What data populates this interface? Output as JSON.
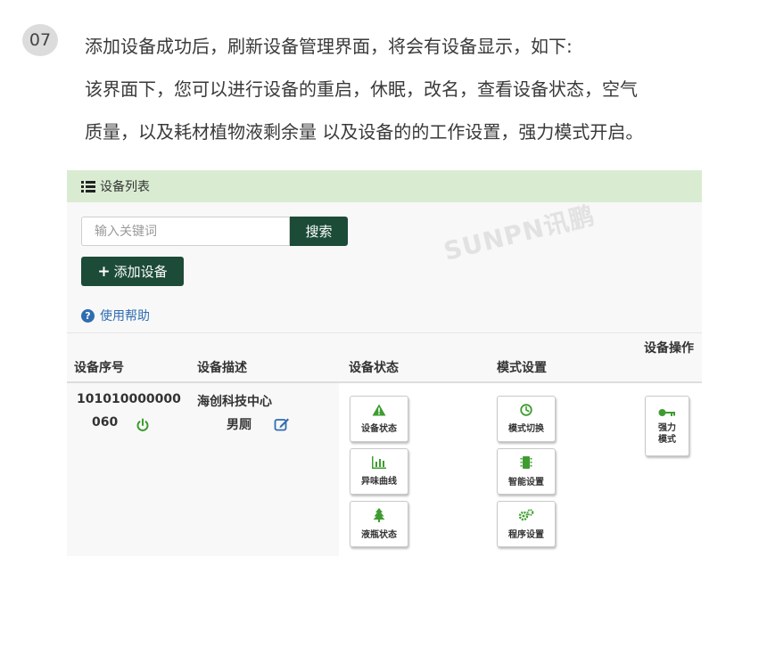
{
  "instruction": {
    "step": "07",
    "lines": [
      "添加设备成功后，刷新设备管理界面，将会有设备显示，如下:",
      "该界面下，您可以进行设备的重启，休眠，改名，查看设备状态，空气",
      "质量，以及耗材植物液剩余量 以及设备的的工作设置，强力模式开启。"
    ]
  },
  "panel": {
    "header_title": "设备列表",
    "search": {
      "placeholder": "输入关键词",
      "value": ""
    },
    "search_button": "搜索",
    "add_button": "添加设备",
    "help_link": "使用帮助",
    "watermark": "SUNPN讯鹏"
  },
  "table": {
    "columns": [
      "设备序号",
      "设备描述",
      "设备状态",
      "模式设置",
      "设备操作"
    ],
    "row": {
      "serial_line1": "101010000000",
      "serial_line2": "060",
      "desc_line1": "海创科技中心",
      "desc_line2": "男厕",
      "status_buttons": [
        "设备状态",
        "异味曲线",
        "液瓶状态"
      ],
      "mode_buttons": [
        "模式切换",
        "智能设置",
        "程序设置"
      ],
      "operation_button": "强力模式"
    }
  },
  "colors": {
    "accent": "#1c4b38",
    "header_bg": "#d9ecd2",
    "icon_green": "#3e9c2f",
    "link_blue": "#2f6db0"
  },
  "icons": {
    "header": "list-icon",
    "help": "question-circle-icon",
    "power": "power-icon",
    "edit": "edit-icon",
    "status": [
      "warning-icon",
      "bar-chart-icon",
      "tree-icon"
    ],
    "mode": [
      "clock-icon",
      "chip-icon",
      "gears-icon"
    ],
    "operation": "key-icon"
  }
}
